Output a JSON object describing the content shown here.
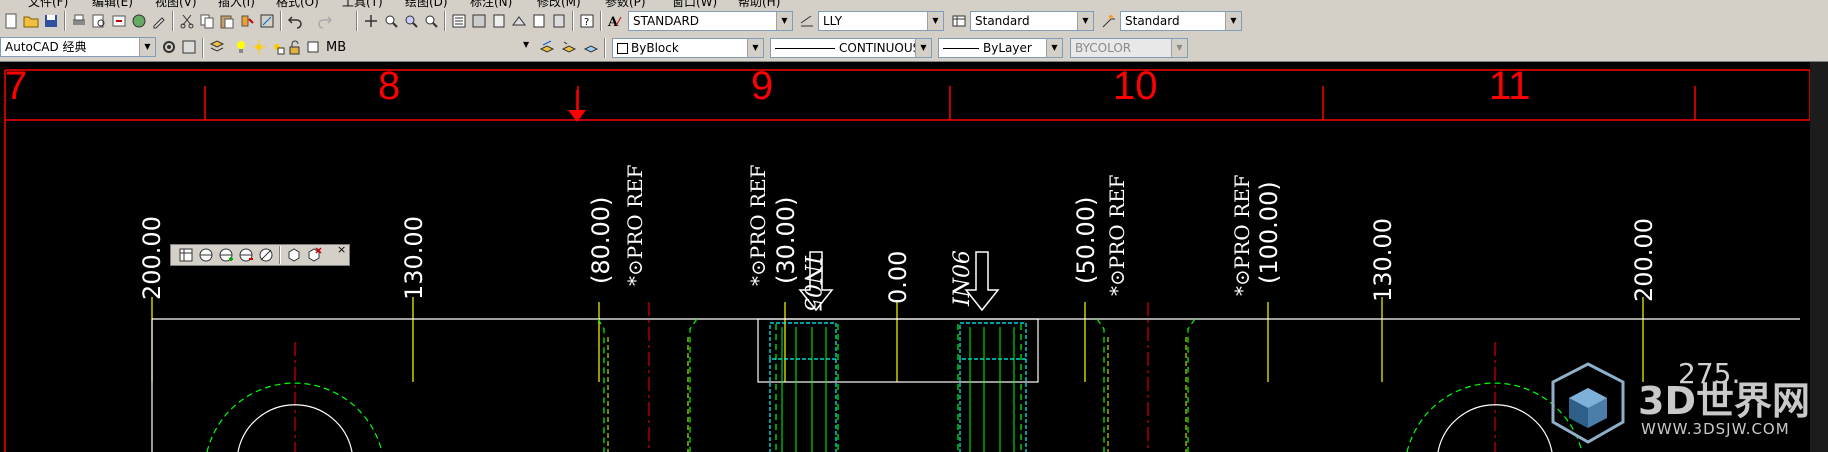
{
  "menubar": {
    "items": [
      "文件(F)",
      "编辑(E)",
      "视图(V)",
      "插入(I)",
      "格式(O)",
      "工具(T)",
      "绘图(D)",
      "标注(N)",
      "修改(M)",
      "参数(P)",
      "窗口(W)",
      "帮助(H)"
    ]
  },
  "toolbar1": {
    "text_style": "STANDARD",
    "dim_style": "LLY",
    "table_style": "Standard",
    "multileader_style": "Standard"
  },
  "toolbar2": {
    "workspace": "AutoCAD 经典",
    "layer": "MB",
    "color": "ByBlock",
    "linetype": "CONTINUOUS",
    "lineweight": "ByLayer",
    "plotstyle": "BYCOLOR"
  },
  "drawing": {
    "ruler_numbers": [
      "7",
      "8",
      "9",
      "10",
      "11"
    ],
    "dimensions": [
      "200.00",
      "130.00",
      "(80.00)",
      "(30.00)",
      "0.00",
      "(50.00)",
      "(100.00)",
      "130.00",
      "200.00"
    ],
    "pro_ref_labels": [
      "*⊙PRO REF",
      "*⊙PRO REF",
      "*⊙PRO REF",
      "*⊙PRO REF"
    ],
    "pin_labels": [
      "IN05",
      "IN06"
    ],
    "corner_dim": "275."
  },
  "watermark": {
    "title": "3D世界网",
    "url": "WWW.3DSJW.COM"
  },
  "colors": {
    "background": "#000000",
    "ruler": "#ff0000",
    "yellow": "#ffff00",
    "green": "#00ff00",
    "cyan": "#00ffff",
    "toolbar": "#d4d0c8"
  }
}
